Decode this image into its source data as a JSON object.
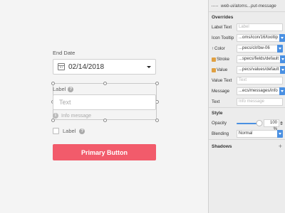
{
  "canvas": {
    "date_label": "End Date",
    "date_value": "02/14/2018",
    "field_label": "Label",
    "input_placeholder": "Text",
    "info_message": "Info message",
    "checkbox_label": "Label",
    "primary_button": "Primary Button"
  },
  "inspector": {
    "symbol_name": "web-ui/atoms...put-message",
    "overrides_title": "Overrides",
    "props": {
      "label_text": {
        "label": "Label Text",
        "value": "Label"
      },
      "icon_tooltip": {
        "label": "Icon Tooltip",
        "value": "...oms/icon/16/tooltip"
      },
      "color": {
        "label": "Color",
        "value": "...pecs/clr/bw-06"
      },
      "stroke": {
        "label": "Stroke",
        "value": "...specs/fields/default"
      },
      "value": {
        "label": "Value",
        "value": "...pecs/values/default"
      },
      "value_text": {
        "label": "Value Text",
        "value": "Text"
      },
      "message": {
        "label": "Message",
        "value": "...ecs/messages/info"
      },
      "text": {
        "label": "Text",
        "value": "Info message"
      }
    },
    "style_title": "Style",
    "opacity": {
      "label": "Opacity",
      "value": "100 %",
      "level": 1.0
    },
    "blending": {
      "label": "Blending",
      "value": "Normal"
    },
    "shadows_title": "Shadows"
  },
  "colors": {
    "primary": "#f25b6b",
    "accent": "#4a90e2"
  }
}
